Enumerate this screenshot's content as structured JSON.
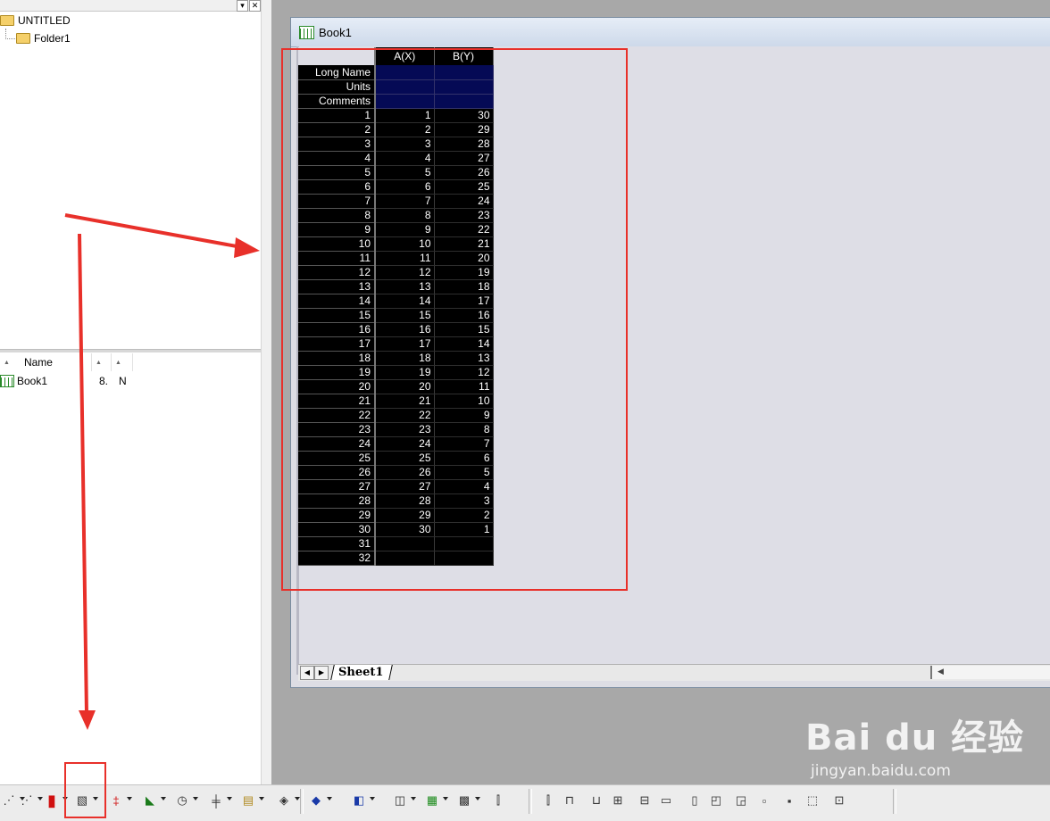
{
  "explorer": {
    "project_name": "UNTITLED",
    "folder_name": "Folder1",
    "list_headers": [
      "Name",
      "",
      ""
    ],
    "items": [
      {
        "name": "Book1",
        "col2": "8.",
        "col3": "N"
      }
    ]
  },
  "workbook": {
    "title": "Book1",
    "columns": [
      "A(X)",
      "B(Y)"
    ],
    "meta_rows": [
      "Long Name",
      "Units",
      "Comments"
    ],
    "rows": [
      {
        "label": "1",
        "a": "1",
        "b": "30"
      },
      {
        "label": "2",
        "a": "2",
        "b": "29"
      },
      {
        "label": "3",
        "a": "3",
        "b": "28"
      },
      {
        "label": "4",
        "a": "4",
        "b": "27"
      },
      {
        "label": "5",
        "a": "5",
        "b": "26"
      },
      {
        "label": "6",
        "a": "6",
        "b": "25"
      },
      {
        "label": "7",
        "a": "7",
        "b": "24"
      },
      {
        "label": "8",
        "a": "8",
        "b": "23"
      },
      {
        "label": "9",
        "a": "9",
        "b": "22"
      },
      {
        "label": "10",
        "a": "10",
        "b": "21"
      },
      {
        "label": "11",
        "a": "11",
        "b": "20"
      },
      {
        "label": "12",
        "a": "12",
        "b": "19"
      },
      {
        "label": "13",
        "a": "13",
        "b": "18"
      },
      {
        "label": "14",
        "a": "14",
        "b": "17"
      },
      {
        "label": "15",
        "a": "15",
        "b": "16"
      },
      {
        "label": "16",
        "a": "16",
        "b": "15"
      },
      {
        "label": "17",
        "a": "17",
        "b": "14"
      },
      {
        "label": "18",
        "a": "18",
        "b": "13"
      },
      {
        "label": "19",
        "a": "19",
        "b": "12"
      },
      {
        "label": "20",
        "a": "20",
        "b": "11"
      },
      {
        "label": "21",
        "a": "21",
        "b": "10"
      },
      {
        "label": "22",
        "a": "22",
        "b": "9"
      },
      {
        "label": "23",
        "a": "23",
        "b": "8"
      },
      {
        "label": "24",
        "a": "24",
        "b": "7"
      },
      {
        "label": "25",
        "a": "25",
        "b": "6"
      },
      {
        "label": "26",
        "a": "26",
        "b": "5"
      },
      {
        "label": "27",
        "a": "27",
        "b": "4"
      },
      {
        "label": "28",
        "a": "28",
        "b": "3"
      },
      {
        "label": "29",
        "a": "29",
        "b": "2"
      },
      {
        "label": "30",
        "a": "30",
        "b": "1"
      },
      {
        "label": "31",
        "a": "",
        "b": ""
      },
      {
        "label": "32",
        "a": "",
        "b": ""
      }
    ],
    "sheet_tab": "Sheet1"
  },
  "toolbar": {
    "buttons": [
      "scatter-plot-icon",
      "line-symbol-plot-icon",
      "column-chart-icon",
      "template-plot-icon",
      "error-bar-icon",
      "area-plot-icon",
      "polar-plot-icon",
      "candlestick-icon",
      "box-plot-icon",
      "3d-plot-icon",
      "3d-bar-icon",
      "3d-surface-icon",
      "3d-wire-icon",
      "contour-plot-icon",
      "image-plot-icon",
      "align-left-icon",
      "align-right-icon",
      "align-top-icon",
      "align-bottom-icon",
      "distribute-h-icon",
      "distribute-v-icon",
      "same-width-icon",
      "same-height-icon",
      "bring-front-icon",
      "send-back-icon",
      "group-icon",
      "ungroup-icon",
      "resize-icon",
      "crop-icon"
    ]
  },
  "watermark": {
    "main": "Bai du 经验",
    "sub": "jingyan.baidu.com"
  },
  "colors": {
    "annotation_red": "#e8302a",
    "grid_black": "#000000",
    "meta_navy": "#050a55"
  }
}
